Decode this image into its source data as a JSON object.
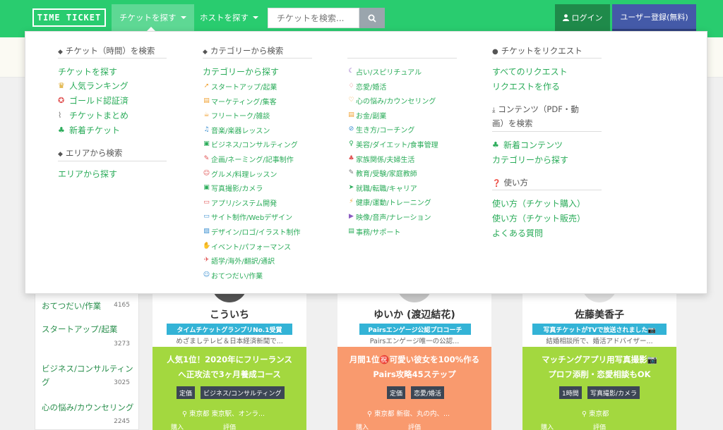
{
  "header": {
    "logo": "TIME TICKET",
    "nav_tickets": "チケットを探す",
    "nav_hosts": "ホストを探す",
    "search_placeholder": "チケットを検索...",
    "login": "ログイン",
    "register": "ユーザー登録(無料)",
    "colors": {
      "bar": "#29cc6f",
      "register": "#445aa8",
      "login": "#1f8a4a"
    }
  },
  "menu": {
    "col1": {
      "title": "チケット（時間）を検索",
      "links": [
        {
          "label": "チケットを探す",
          "icon": ""
        },
        {
          "label": "人気ランキング",
          "icon": "trophy-icon"
        },
        {
          "label": "ゴールド認証済",
          "icon": "medal-icon"
        },
        {
          "label": "チケットまとめ",
          "icon": "paperclip-icon"
        },
        {
          "label": "新着チケット",
          "icon": "sprout-icon"
        }
      ],
      "area_title": "エリアから検索",
      "area_link": "エリアから探す"
    },
    "col2": {
      "title": "カテゴリーから検索",
      "top_link": "カテゴリーから探す",
      "cats": [
        {
          "label": "スタートアップ/起業",
          "icon": "rocket-icon",
          "color": "#f0a030",
          "glyph": "➚"
        },
        {
          "label": "マーケティング/集客",
          "icon": "chart-icon",
          "color": "#f0a030",
          "glyph": "▤"
        },
        {
          "label": "フリートーク/雑談",
          "icon": "cup-icon",
          "color": "#f0a030",
          "glyph": "☕"
        },
        {
          "label": "音楽/楽器レッスン",
          "icon": "music-icon",
          "color": "#3a8fd0",
          "glyph": "♫"
        },
        {
          "label": "ビジネス/コンサルティング",
          "icon": "briefcase-icon",
          "color": "#2bac5a",
          "glyph": "▣"
        },
        {
          "label": "企画/ネーミング/記事制作",
          "icon": "bulb-icon",
          "color": "#e05050",
          "glyph": "✎"
        },
        {
          "label": "グルメ/料理レッスン",
          "icon": "smile-icon",
          "color": "#e05050",
          "glyph": "☺"
        },
        {
          "label": "写真撮影/カメラ",
          "icon": "camera-icon",
          "color": "#2bac5a",
          "glyph": "▣"
        },
        {
          "label": "アプリ/システム開発",
          "icon": "app-icon",
          "color": "#e05050",
          "glyph": "▭"
        },
        {
          "label": "サイト制作/Webデザイン",
          "icon": "laptop-icon",
          "color": "#3a8fd0",
          "glyph": "▭"
        },
        {
          "label": "デザイン/ロゴ/イラスト制作",
          "icon": "image-icon",
          "color": "#3a8fd0",
          "glyph": "▨"
        },
        {
          "label": "イベント/パフォーマンス",
          "icon": "thumb-icon",
          "color": "#8a5ac0",
          "glyph": "✋"
        },
        {
          "label": "語学/海外/翻訳/通訳",
          "icon": "plane-icon",
          "color": "#e05050",
          "glyph": "✈"
        },
        {
          "label": "おてつだい/作業",
          "icon": "hand-icon",
          "color": "#3a8fd0",
          "glyph": "☺"
        }
      ]
    },
    "col3": {
      "cats": [
        {
          "label": "占い/スピリチュアル",
          "icon": "moon-icon",
          "color": "#8a5ac0",
          "glyph": "☾"
        },
        {
          "label": "恋愛/婚活",
          "icon": "diamond-icon",
          "color": "#e05050",
          "glyph": "♢"
        },
        {
          "label": "心の悩み/カウンセリング",
          "icon": "heart-icon",
          "color": "#f0a030",
          "glyph": "♡"
        },
        {
          "label": "お金/副業",
          "icon": "money-icon",
          "color": "#f0a030",
          "glyph": "▤"
        },
        {
          "label": "生き方/コーチング",
          "icon": "compass-icon",
          "color": "#3a8fd0",
          "glyph": "⊘"
        },
        {
          "label": "美容/ダイエット/食事管理",
          "icon": "person-icon",
          "color": "#2bac5a",
          "glyph": "♀"
        },
        {
          "label": "家族関係/夫婦生活",
          "icon": "family-icon",
          "color": "#e05050",
          "glyph": "♣"
        },
        {
          "label": "教育/受験/家庭教師",
          "icon": "edit-icon",
          "color": "#777777",
          "glyph": "✎"
        },
        {
          "label": "就職/転職/キャリア",
          "icon": "send-icon",
          "color": "#2bac5a",
          "glyph": "➤"
        },
        {
          "label": "健康/運動/トレーニング",
          "icon": "run-icon",
          "color": "#f0a030",
          "glyph": "⚡"
        },
        {
          "label": "映像/音声/ナレーション",
          "icon": "video-icon",
          "color": "#8a5ac0",
          "glyph": "▶"
        },
        {
          "label": "事務/サポート",
          "icon": "file-icon",
          "color": "#2bac5a",
          "glyph": "▤"
        }
      ]
    },
    "col4": {
      "req_title": "チケットをリクエスト",
      "req_links": [
        "すべてのリクエスト",
        "リクエストを作る"
      ],
      "content_title_1": "コンテンツ（PDF・動",
      "content_title_2": "画）を検索",
      "content_links": [
        {
          "label": "新着コンテンツ",
          "icon": "sprout-icon"
        },
        {
          "label": "カテゴリーから探す",
          "icon": ""
        }
      ],
      "howto_title": "使い方",
      "howto_links": [
        "使い方（チケット購入）",
        "使い方（チケット販売）",
        "よくある質問"
      ]
    }
  },
  "left_panel": {
    "items": [
      {
        "label": "おてつだい/作業",
        "count": "4165"
      },
      {
        "label": "スタートアップ/起業",
        "count": "3273"
      },
      {
        "label": "ビジネス/コンサルティン",
        "label2": "グ",
        "count": "3025"
      },
      {
        "label": "心の悩み/カウンセリング",
        "count": "2245"
      }
    ]
  },
  "cards": [
    {
      "name": "こういち",
      "badge": "タイムチケットグランプリNo.1受賞",
      "sub": "めざましテレビ＆日本経済新聞で...",
      "line1": "人気1位！2020年にフリーランス",
      "line2": "へ正攻法で3ヶ月養成コース",
      "tags": [
        "定価",
        "ビジネス/コンサルティング"
      ],
      "loc": "東京都 東京駅、オンラ...",
      "foot": [
        "購入",
        "評価"
      ],
      "color": "#a3d83f"
    },
    {
      "name": "ゆいか (渡辺結花)",
      "badge": "Pairsエンゲージ公認プロコーチ",
      "sub": "Pairsエンゲージ唯一の公認...",
      "line1": "月間1位㊗️可愛い彼女を100%作る",
      "line2": "Pairs攻略45ステップ",
      "tags": [
        "定価",
        "恋愛/婚活"
      ],
      "loc": "東京都 新宿、丸の内、...",
      "foot": [
        "購入",
        "評価"
      ],
      "color": "#f99a6e"
    },
    {
      "name": "佐藤美香子",
      "badge": "写真チケットがTVで放送されました📷",
      "sub": "結婚相談所で、婚活アドバイザー...",
      "line1": "マッチングアプリ用写真撮影📷",
      "line2": "プロフ添削・恋愛相談もOK",
      "tags": [
        "1時間",
        "写真撮影/カメラ"
      ],
      "loc": "東京都",
      "foot": [
        "購入",
        "評価"
      ],
      "color": "#a3d83f"
    }
  ]
}
